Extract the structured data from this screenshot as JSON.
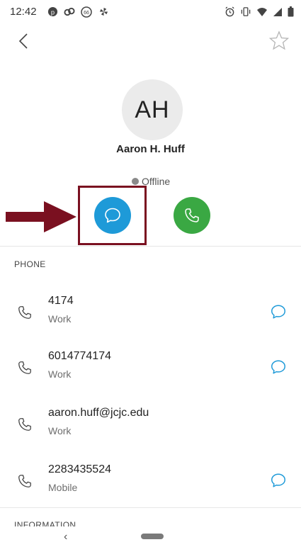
{
  "status_bar": {
    "time": "12:42",
    "left_icons": [
      "pinterest-icon",
      "app-icon",
      "badge-66-icon",
      "pinwheel-icon"
    ],
    "right_icons": [
      "alarm-icon",
      "vibrate-icon",
      "wifi-icon",
      "signal-icon",
      "battery-icon"
    ],
    "badge_text": "66"
  },
  "contact": {
    "initials": "AH",
    "name": "Aaron H. Huff",
    "presence": "Offline",
    "presence_color": "#8a8a8a"
  },
  "actions": {
    "chat_color": "#1e9ad8",
    "call_color": "#3aa843",
    "highlight_color": "#7a1020"
  },
  "phone_section": {
    "header": "PHONE",
    "rows": [
      {
        "value": "4174",
        "label": "Work",
        "has_chat": true
      },
      {
        "value": "6014774174",
        "label": "Work",
        "has_chat": true
      },
      {
        "value": "aaron.huff@jcjc.edu",
        "label": "Work",
        "has_chat": false
      },
      {
        "value": "2283435524",
        "label": "Mobile",
        "has_chat": true
      }
    ]
  },
  "information_section": {
    "header": "INFORMATION"
  },
  "nav_bar": {
    "back_glyph": "‹"
  }
}
